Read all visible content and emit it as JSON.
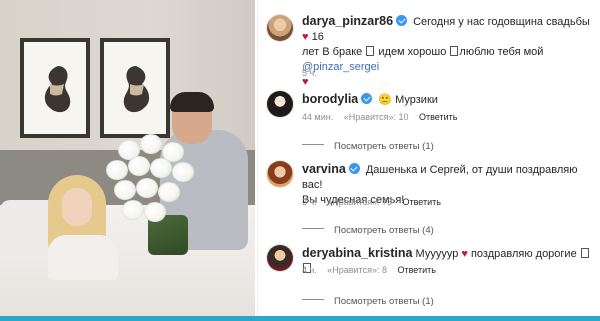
{
  "post": {
    "author": "darya_pinzar86",
    "caption_line1": "Сегодня у нас годовщина свадьбы",
    "caption_line1_tail": "16",
    "caption_line2_a": "лет В браке",
    "caption_line2_b": "идем хорошо",
    "caption_line2_c": "люблю тебя мой",
    "mention": "@pinzar_sergei",
    "time": "5 ч."
  },
  "comments": [
    {
      "username": "borodylia",
      "verified": true,
      "emoji": "🙂",
      "text": "Мурзики",
      "time": "44 мин.",
      "likes": "«Нравится»: 10",
      "reply": "Ответить",
      "view_replies": "Посмотреть ответы (1)"
    },
    {
      "username": "varvina",
      "verified": true,
      "text_line1": "Дашенька и Сергей, от души поздравляю вас!",
      "text_line2": "Вы чудесная семья!",
      "time": "3 ч.",
      "likes": "«Нравится»: 73",
      "reply": "Ответить",
      "view_replies": "Посмотреть ответы (4)"
    },
    {
      "username": "deryabina_kristina",
      "verified": false,
      "text_a": "Мууууур",
      "text_b": "поздравляю дорогие",
      "time": "4 ч.",
      "likes": "«Нравится»: 8",
      "reply": "Ответить",
      "view_replies": "Посмотреть ответы (1)"
    }
  ],
  "icons": {
    "verified": "verified-badge-icon",
    "heart": "heart-icon"
  },
  "colors": {
    "verified": "#3897f0",
    "heart": "#c4183c",
    "mention": "#3d6fb6",
    "meta": "#8e8e8e",
    "frame_accent": "#2aa7c9"
  }
}
